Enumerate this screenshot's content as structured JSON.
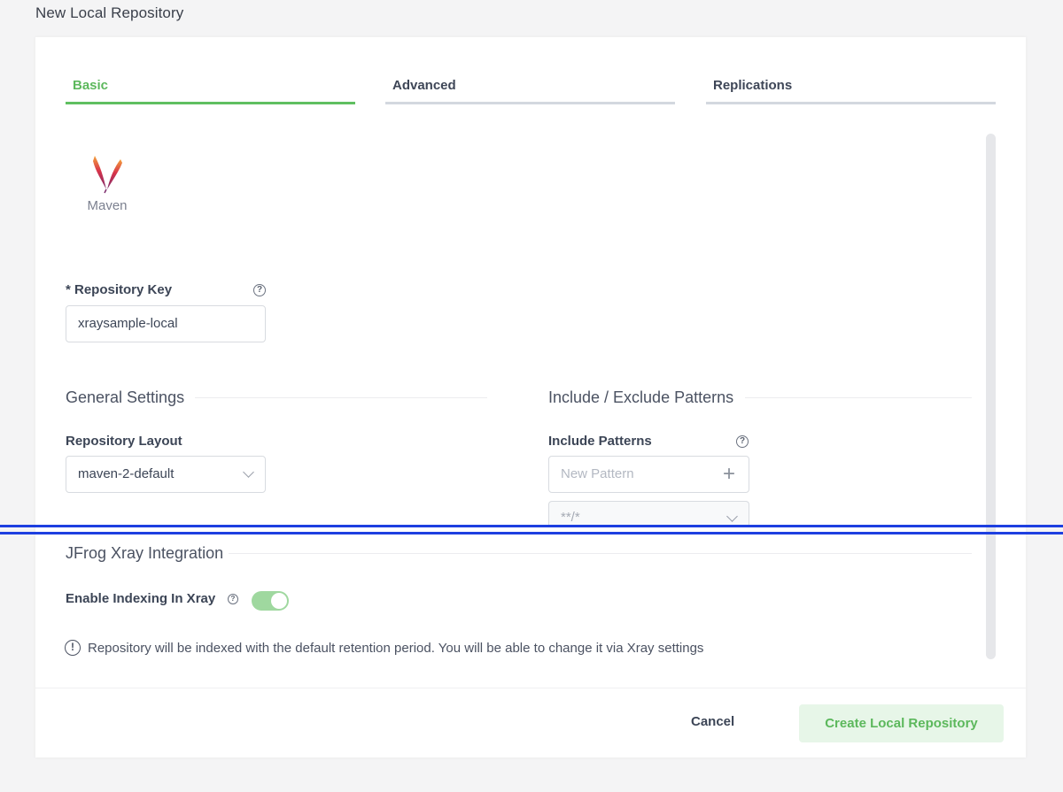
{
  "page": {
    "title": "New Local Repository"
  },
  "tabs": [
    {
      "label": "Basic"
    },
    {
      "label": "Advanced"
    },
    {
      "label": "Replications"
    }
  ],
  "package": {
    "label": "Maven",
    "icon": "maven-feather-icon"
  },
  "repo_key": {
    "label": "* Repository Key",
    "value": "xraysample-local"
  },
  "general": {
    "title": "General Settings",
    "layout_label": "Repository Layout",
    "layout_value": "maven-2-default"
  },
  "patterns": {
    "title": "Include / Exclude Patterns",
    "include_label": "Include Patterns",
    "new_placeholder": "New Pattern",
    "existing_value": "**/*"
  },
  "xray": {
    "title": "JFrog Xray Integration",
    "indexing_label": "Enable Indexing In Xray",
    "indexing_enabled": true,
    "info_text": "Repository will be indexed with the default retention period. You will be able to change it via Xray settings"
  },
  "footer": {
    "cancel_label": "Cancel",
    "create_label": "Create Local Repository"
  },
  "colors": {
    "accent": "#5fbf60",
    "marker_line": "#1d3fe0"
  }
}
